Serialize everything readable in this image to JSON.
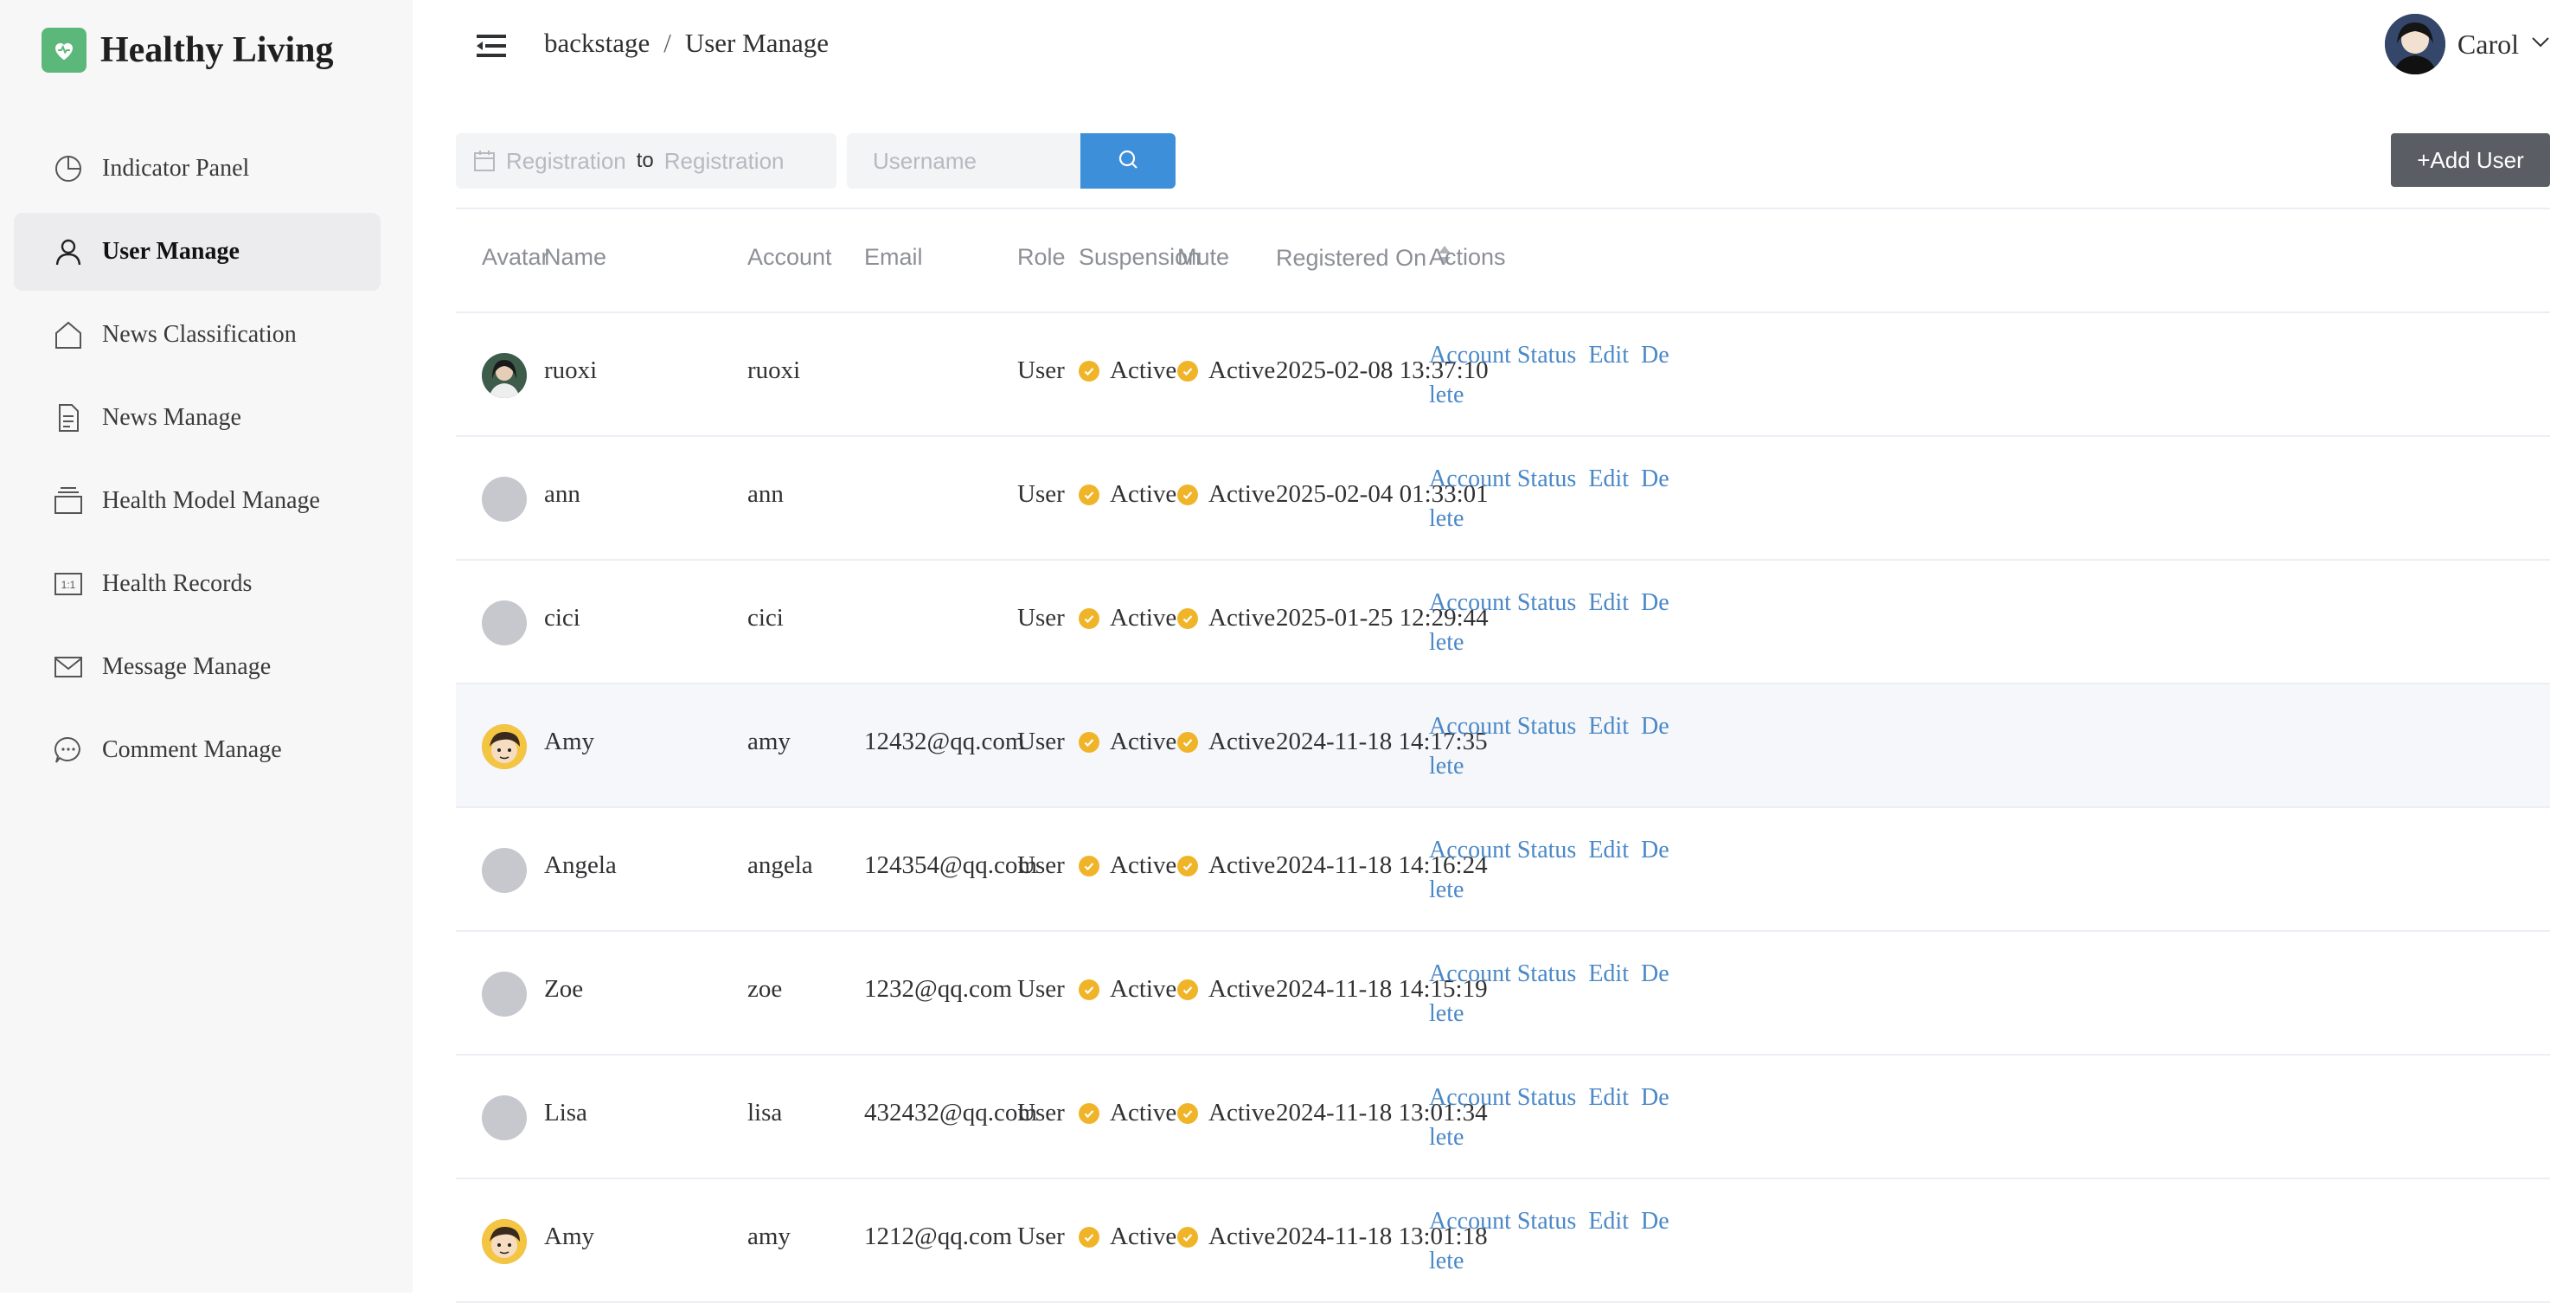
{
  "app": {
    "title": "Healthy Living"
  },
  "sidebar": {
    "items": [
      {
        "label": "Indicator Panel",
        "icon": "pie-chart-icon"
      },
      {
        "label": "User Manage",
        "icon": "user-icon"
      },
      {
        "label": "News Classification",
        "icon": "house-icon"
      },
      {
        "label": "News Manage",
        "icon": "document-icon"
      },
      {
        "label": "Health Model Manage",
        "icon": "stack-icon"
      },
      {
        "label": "Health Records",
        "icon": "records-icon"
      },
      {
        "label": "Message Manage",
        "icon": "envelope-icon"
      },
      {
        "label": "Comment Manage",
        "icon": "chat-bubble-icon"
      }
    ],
    "active_index": 1
  },
  "header": {
    "breadcrumb": [
      "backstage",
      "User Manage"
    ],
    "breadcrumb_sep": "/",
    "user_name": "Carol"
  },
  "toolbar": {
    "date_start_placeholder": "Registration",
    "date_to": "to",
    "date_end_placeholder": "Registration",
    "username_placeholder": "Username",
    "add_user_label": "+Add User"
  },
  "table": {
    "columns": [
      "Avatar",
      "Name",
      "Account",
      "Email",
      "Role",
      "Suspension",
      "Mute",
      "Registered On",
      "Actions"
    ],
    "rows": [
      {
        "avatar": "photo-woman",
        "name": "ruoxi",
        "account": "ruoxi",
        "email": "",
        "role": "User",
        "suspension": "Active",
        "mute": "Active",
        "registered": "2025-02-08 13:37:10"
      },
      {
        "avatar": "placeholder",
        "name": "ann",
        "account": "ann",
        "email": "",
        "role": "User",
        "suspension": "Active",
        "mute": "Active",
        "registered": "2025-02-04 01:33:01"
      },
      {
        "avatar": "placeholder",
        "name": "cici",
        "account": "cici",
        "email": "",
        "role": "User",
        "suspension": "Active",
        "mute": "Active",
        "registered": "2025-01-25 12:29:44"
      },
      {
        "avatar": "cartoon-face",
        "name": "Amy",
        "account": "amy",
        "email": "12432@qq.com",
        "role": "User",
        "suspension": "Active",
        "mute": "Active",
        "registered": "2024-11-18 14:17:35"
      },
      {
        "avatar": "placeholder",
        "name": "Angela",
        "account": "angela",
        "email": "124354@qq.com",
        "role": "User",
        "suspension": "Active",
        "mute": "Active",
        "registered": "2024-11-18 14:16:24"
      },
      {
        "avatar": "placeholder",
        "name": "Zoe",
        "account": "zoe",
        "email": "1232@qq.com",
        "role": "User",
        "suspension": "Active",
        "mute": "Active",
        "registered": "2024-11-18 14:15:19"
      },
      {
        "avatar": "placeholder",
        "name": "Lisa",
        "account": "lisa",
        "email": "432432@qq.com",
        "role": "User",
        "suspension": "Active",
        "mute": "Active",
        "registered": "2024-11-18 13:01:34"
      },
      {
        "avatar": "cartoon-face",
        "name": "Amy",
        "account": "amy",
        "email": "1212@qq.com",
        "role": "User",
        "suspension": "Active",
        "mute": "Active",
        "registered": "2024-11-18 13:01:18"
      }
    ],
    "highlighted_row": 3,
    "action_labels": {
      "account_status": "Account Status",
      "edit": "Edit",
      "delete_part1": "De",
      "delete_part2": "lete"
    }
  },
  "colors": {
    "accent": "#3d8fd9",
    "link": "#4a88c7",
    "status": "#f0b429",
    "logo": "#5cb87a",
    "add_button": "#5a5d63"
  }
}
